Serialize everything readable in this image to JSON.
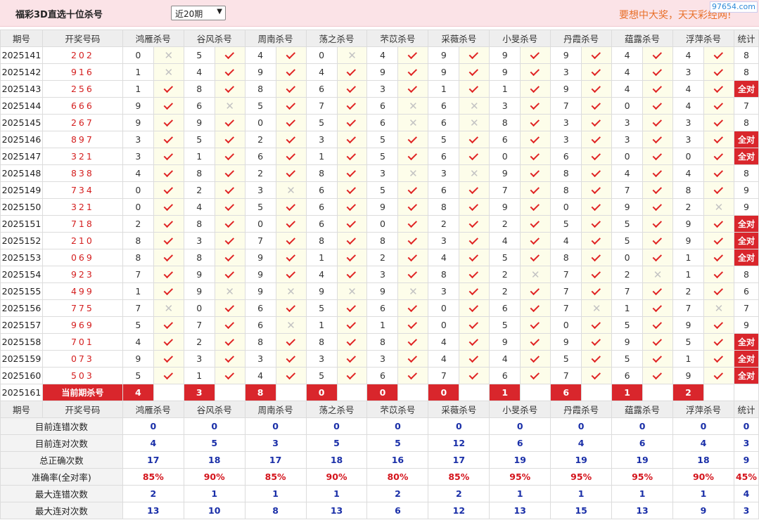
{
  "header": {
    "title": "福彩3D直选十位杀号",
    "period": "近20期",
    "slogan": "要想中大奖，天天彩经网!",
    "site": "97654.com"
  },
  "cols": {
    "issue": "期号",
    "code": "开奖号码",
    "stat": "统计",
    "experts": [
      "鸿雁杀号",
      "谷风杀号",
      "周南杀号",
      "荡之杀号",
      "芣苡杀号",
      "采薇杀号",
      "小旻杀号",
      "丹霞杀号",
      "蕴露杀号",
      "浮萍杀号"
    ]
  },
  "rows": [
    {
      "issue": "2025141",
      "code": "202",
      "k": [
        [
          0,
          0
        ],
        [
          5,
          1
        ],
        [
          4,
          1
        ],
        [
          0,
          0
        ],
        [
          4,
          1
        ],
        [
          9,
          1
        ],
        [
          9,
          1
        ],
        [
          9,
          1
        ],
        [
          4,
          1
        ],
        [
          4,
          1
        ]
      ],
      "s": "8"
    },
    {
      "issue": "2025142",
      "code": "916",
      "k": [
        [
          1,
          0
        ],
        [
          4,
          1
        ],
        [
          9,
          1
        ],
        [
          4,
          1
        ],
        [
          9,
          1
        ],
        [
          9,
          1
        ],
        [
          9,
          1
        ],
        [
          3,
          1
        ],
        [
          4,
          1
        ],
        [
          3,
          1
        ]
      ],
      "s": "8"
    },
    {
      "issue": "2025143",
      "code": "256",
      "k": [
        [
          1,
          1
        ],
        [
          8,
          1
        ],
        [
          8,
          1
        ],
        [
          6,
          1
        ],
        [
          3,
          1
        ],
        [
          1,
          1
        ],
        [
          1,
          1
        ],
        [
          9,
          1
        ],
        [
          4,
          1
        ],
        [
          4,
          1
        ]
      ],
      "s": "全对"
    },
    {
      "issue": "2025144",
      "code": "666",
      "k": [
        [
          9,
          1
        ],
        [
          6,
          0
        ],
        [
          5,
          1
        ],
        [
          7,
          1
        ],
        [
          6,
          0
        ],
        [
          6,
          0
        ],
        [
          3,
          1
        ],
        [
          7,
          1
        ],
        [
          0,
          1
        ],
        [
          4,
          1
        ]
      ],
      "s": "7"
    },
    {
      "issue": "2025145",
      "code": "267",
      "k": [
        [
          9,
          1
        ],
        [
          9,
          1
        ],
        [
          0,
          1
        ],
        [
          5,
          1
        ],
        [
          6,
          0
        ],
        [
          6,
          0
        ],
        [
          8,
          1
        ],
        [
          3,
          1
        ],
        [
          3,
          1
        ],
        [
          3,
          1
        ]
      ],
      "s": "8"
    },
    {
      "issue": "2025146",
      "code": "897",
      "k": [
        [
          3,
          1
        ],
        [
          5,
          1
        ],
        [
          2,
          1
        ],
        [
          3,
          1
        ],
        [
          5,
          1
        ],
        [
          5,
          1
        ],
        [
          6,
          1
        ],
        [
          3,
          1
        ],
        [
          3,
          1
        ],
        [
          3,
          1
        ]
      ],
      "s": "全对"
    },
    {
      "issue": "2025147",
      "code": "321",
      "k": [
        [
          3,
          1
        ],
        [
          1,
          1
        ],
        [
          6,
          1
        ],
        [
          1,
          1
        ],
        [
          5,
          1
        ],
        [
          6,
          1
        ],
        [
          0,
          1
        ],
        [
          6,
          1
        ],
        [
          0,
          1
        ],
        [
          0,
          1
        ]
      ],
      "s": "全对"
    },
    {
      "issue": "2025148",
      "code": "838",
      "k": [
        [
          4,
          1
        ],
        [
          8,
          1
        ],
        [
          2,
          1
        ],
        [
          8,
          1
        ],
        [
          3,
          0
        ],
        [
          3,
          0
        ],
        [
          9,
          1
        ],
        [
          8,
          1
        ],
        [
          4,
          1
        ],
        [
          4,
          1
        ]
      ],
      "s": "8"
    },
    {
      "issue": "2025149",
      "code": "734",
      "k": [
        [
          0,
          1
        ],
        [
          2,
          1
        ],
        [
          3,
          0
        ],
        [
          6,
          1
        ],
        [
          5,
          1
        ],
        [
          6,
          1
        ],
        [
          7,
          1
        ],
        [
          8,
          1
        ],
        [
          7,
          1
        ],
        [
          8,
          1
        ]
      ],
      "s": "9"
    },
    {
      "issue": "2025150",
      "code": "321",
      "k": [
        [
          0,
          1
        ],
        [
          4,
          1
        ],
        [
          5,
          1
        ],
        [
          6,
          1
        ],
        [
          9,
          1
        ],
        [
          8,
          1
        ],
        [
          9,
          1
        ],
        [
          0,
          1
        ],
        [
          9,
          1
        ],
        [
          2,
          0
        ]
      ],
      "s": "9"
    },
    {
      "issue": "2025151",
      "code": "718",
      "k": [
        [
          2,
          1
        ],
        [
          8,
          1
        ],
        [
          0,
          1
        ],
        [
          6,
          1
        ],
        [
          0,
          1
        ],
        [
          2,
          1
        ],
        [
          2,
          1
        ],
        [
          5,
          1
        ],
        [
          5,
          1
        ],
        [
          9,
          1
        ]
      ],
      "s": "全对"
    },
    {
      "issue": "2025152",
      "code": "210",
      "k": [
        [
          8,
          1
        ],
        [
          3,
          1
        ],
        [
          7,
          1
        ],
        [
          8,
          1
        ],
        [
          8,
          1
        ],
        [
          3,
          1
        ],
        [
          4,
          1
        ],
        [
          4,
          1
        ],
        [
          5,
          1
        ],
        [
          9,
          1
        ]
      ],
      "s": "全对"
    },
    {
      "issue": "2025153",
      "code": "069",
      "k": [
        [
          8,
          1
        ],
        [
          8,
          1
        ],
        [
          9,
          1
        ],
        [
          1,
          1
        ],
        [
          2,
          1
        ],
        [
          4,
          1
        ],
        [
          5,
          1
        ],
        [
          8,
          1
        ],
        [
          0,
          1
        ],
        [
          1,
          1
        ]
      ],
      "s": "全对"
    },
    {
      "issue": "2025154",
      "code": "923",
      "k": [
        [
          7,
          1
        ],
        [
          9,
          1
        ],
        [
          9,
          1
        ],
        [
          4,
          1
        ],
        [
          3,
          1
        ],
        [
          8,
          1
        ],
        [
          2,
          0
        ],
        [
          7,
          1
        ],
        [
          2,
          0
        ],
        [
          1,
          1
        ]
      ],
      "s": "8"
    },
    {
      "issue": "2025155",
      "code": "499",
      "k": [
        [
          1,
          1
        ],
        [
          9,
          0
        ],
        [
          9,
          0
        ],
        [
          9,
          0
        ],
        [
          9,
          0
        ],
        [
          3,
          1
        ],
        [
          2,
          1
        ],
        [
          7,
          1
        ],
        [
          7,
          1
        ],
        [
          2,
          1
        ]
      ],
      "s": "6"
    },
    {
      "issue": "2025156",
      "code": "775",
      "k": [
        [
          7,
          0
        ],
        [
          0,
          1
        ],
        [
          6,
          1
        ],
        [
          5,
          1
        ],
        [
          6,
          1
        ],
        [
          0,
          1
        ],
        [
          6,
          1
        ],
        [
          7,
          0
        ],
        [
          1,
          1
        ],
        [
          7,
          0
        ]
      ],
      "s": "7"
    },
    {
      "issue": "2025157",
      "code": "969",
      "k": [
        [
          5,
          1
        ],
        [
          7,
          1
        ],
        [
          6,
          0
        ],
        [
          1,
          1
        ],
        [
          1,
          1
        ],
        [
          0,
          1
        ],
        [
          5,
          1
        ],
        [
          0,
          1
        ],
        [
          5,
          1
        ],
        [
          9,
          1
        ]
      ],
      "s": "9"
    },
    {
      "issue": "2025158",
      "code": "701",
      "k": [
        [
          4,
          1
        ],
        [
          2,
          1
        ],
        [
          8,
          1
        ],
        [
          8,
          1
        ],
        [
          8,
          1
        ],
        [
          4,
          1
        ],
        [
          9,
          1
        ],
        [
          9,
          1
        ],
        [
          9,
          1
        ],
        [
          5,
          1
        ]
      ],
      "s": "全对"
    },
    {
      "issue": "2025159",
      "code": "073",
      "k": [
        [
          9,
          1
        ],
        [
          3,
          1
        ],
        [
          3,
          1
        ],
        [
          3,
          1
        ],
        [
          3,
          1
        ],
        [
          4,
          1
        ],
        [
          4,
          1
        ],
        [
          5,
          1
        ],
        [
          5,
          1
        ],
        [
          1,
          1
        ]
      ],
      "s": "全对"
    },
    {
      "issue": "2025160",
      "code": "503",
      "k": [
        [
          5,
          1
        ],
        [
          1,
          1
        ],
        [
          4,
          1
        ],
        [
          5,
          1
        ],
        [
          6,
          1
        ],
        [
          7,
          1
        ],
        [
          6,
          1
        ],
        [
          7,
          1
        ],
        [
          6,
          1
        ],
        [
          9,
          1
        ]
      ],
      "s": "全对"
    }
  ],
  "current": {
    "issue": "2025161",
    "label": "当前期杀号",
    "picks": [
      "4",
      "3",
      "8",
      "0",
      "0",
      "0",
      "1",
      "6",
      "1",
      "2"
    ]
  },
  "stats": [
    {
      "label": "目前连错次数",
      "v": [
        "0",
        "0",
        "0",
        "0",
        "0",
        "0",
        "0",
        "0",
        "0",
        "0",
        "0"
      ]
    },
    {
      "label": "目前连对次数",
      "v": [
        "4",
        "5",
        "3",
        "5",
        "5",
        "12",
        "6",
        "4",
        "6",
        "4",
        "3"
      ]
    },
    {
      "label": "总正确次数",
      "v": [
        "17",
        "18",
        "17",
        "18",
        "16",
        "17",
        "19",
        "19",
        "19",
        "18",
        "9"
      ]
    },
    {
      "label": "准确率(全对率)",
      "v": [
        "85%",
        "90%",
        "85%",
        "90%",
        "80%",
        "85%",
        "95%",
        "95%",
        "95%",
        "90%",
        "45%"
      ],
      "red": true
    },
    {
      "label": "最大连错次数",
      "v": [
        "2",
        "1",
        "1",
        "1",
        "2",
        "2",
        "1",
        "1",
        "1",
        "1",
        "4"
      ]
    },
    {
      "label": "最大连对次数",
      "v": [
        "13",
        "10",
        "8",
        "13",
        "6",
        "12",
        "13",
        "15",
        "13",
        "9",
        "3"
      ]
    }
  ]
}
